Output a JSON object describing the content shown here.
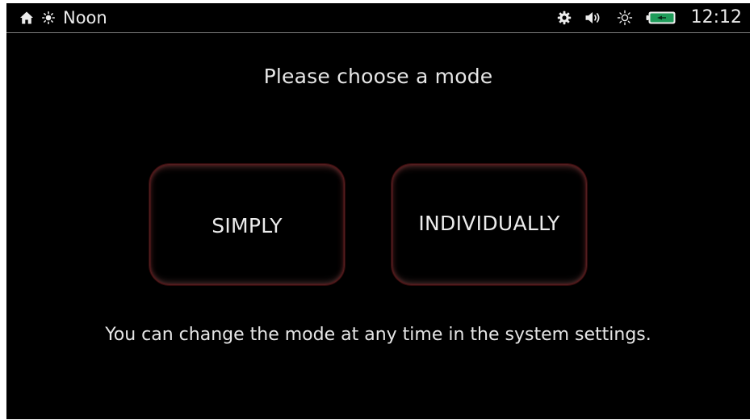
{
  "status_bar": {
    "home_icon": "home-icon",
    "daytime_icon": "sun-small-icon",
    "daytime_label": "Noon",
    "settings_icon": "gear-icon",
    "volume_icon": "speaker-volume-icon",
    "brightness_icon": "sun-outline-icon",
    "battery_icon": "battery-charging-icon",
    "battery_color": "#1f9c5a",
    "time": "12:12"
  },
  "main": {
    "title": "Please choose a mode",
    "modes": [
      {
        "label": "SIMPLY"
      },
      {
        "label": "INDIVIDUALLY"
      }
    ],
    "hint": "You can change the mode at any time in the system settings."
  },
  "colors": {
    "background": "#000000",
    "text": "#e6e6e6",
    "button_accent": "#b0444a"
  }
}
